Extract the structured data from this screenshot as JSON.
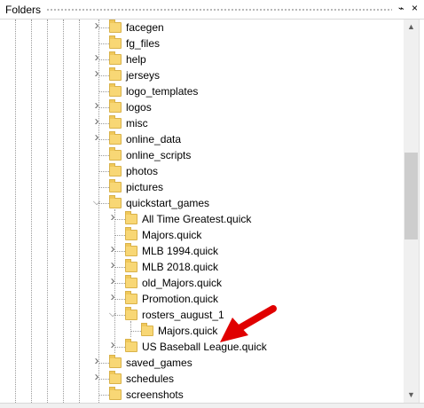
{
  "window": {
    "title": "Folders",
    "pin_glyph": "⌁",
    "close_glyph": "×"
  },
  "tree": {
    "items": [
      {
        "label": "facegen",
        "expandable": true
      },
      {
        "label": "fg_files",
        "expandable": false
      },
      {
        "label": "help",
        "expandable": true
      },
      {
        "label": "jerseys",
        "expandable": true
      },
      {
        "label": "logo_templates",
        "expandable": false
      },
      {
        "label": "logos",
        "expandable": true
      },
      {
        "label": "misc",
        "expandable": true
      },
      {
        "label": "online_data",
        "expandable": true
      },
      {
        "label": "online_scripts",
        "expandable": false
      },
      {
        "label": "photos",
        "expandable": false
      },
      {
        "label": "pictures",
        "expandable": false
      },
      {
        "label": "quickstart_games",
        "expandable": true,
        "expanded": true
      },
      {
        "label": "All Time Greatest.quick",
        "expandable": true
      },
      {
        "label": "Majors.quick",
        "expandable": false
      },
      {
        "label": "MLB 1994.quick",
        "expandable": true
      },
      {
        "label": "MLB 2018.quick",
        "expandable": true
      },
      {
        "label": "old_Majors.quick",
        "expandable": true
      },
      {
        "label": "Promotion.quick",
        "expandable": true
      },
      {
        "label": "rosters_august_1",
        "expandable": true,
        "expanded": true
      },
      {
        "label": "Majors.quick",
        "expandable": false,
        "selected": false
      },
      {
        "label": "US Baseball League.quick",
        "expandable": true
      },
      {
        "label": "saved_games",
        "expandable": true
      },
      {
        "label": "schedules",
        "expandable": true
      },
      {
        "label": "screenshots",
        "expandable": false
      }
    ]
  },
  "annotation": {
    "arrow_color": "#e00000"
  },
  "icons": {
    "collapsed": "chevron-right-icon",
    "expanded": "chevron-down-icon",
    "folder": "folder-icon",
    "scroll_up": "scroll-up-icon",
    "scroll_down": "scroll-down-icon"
  }
}
